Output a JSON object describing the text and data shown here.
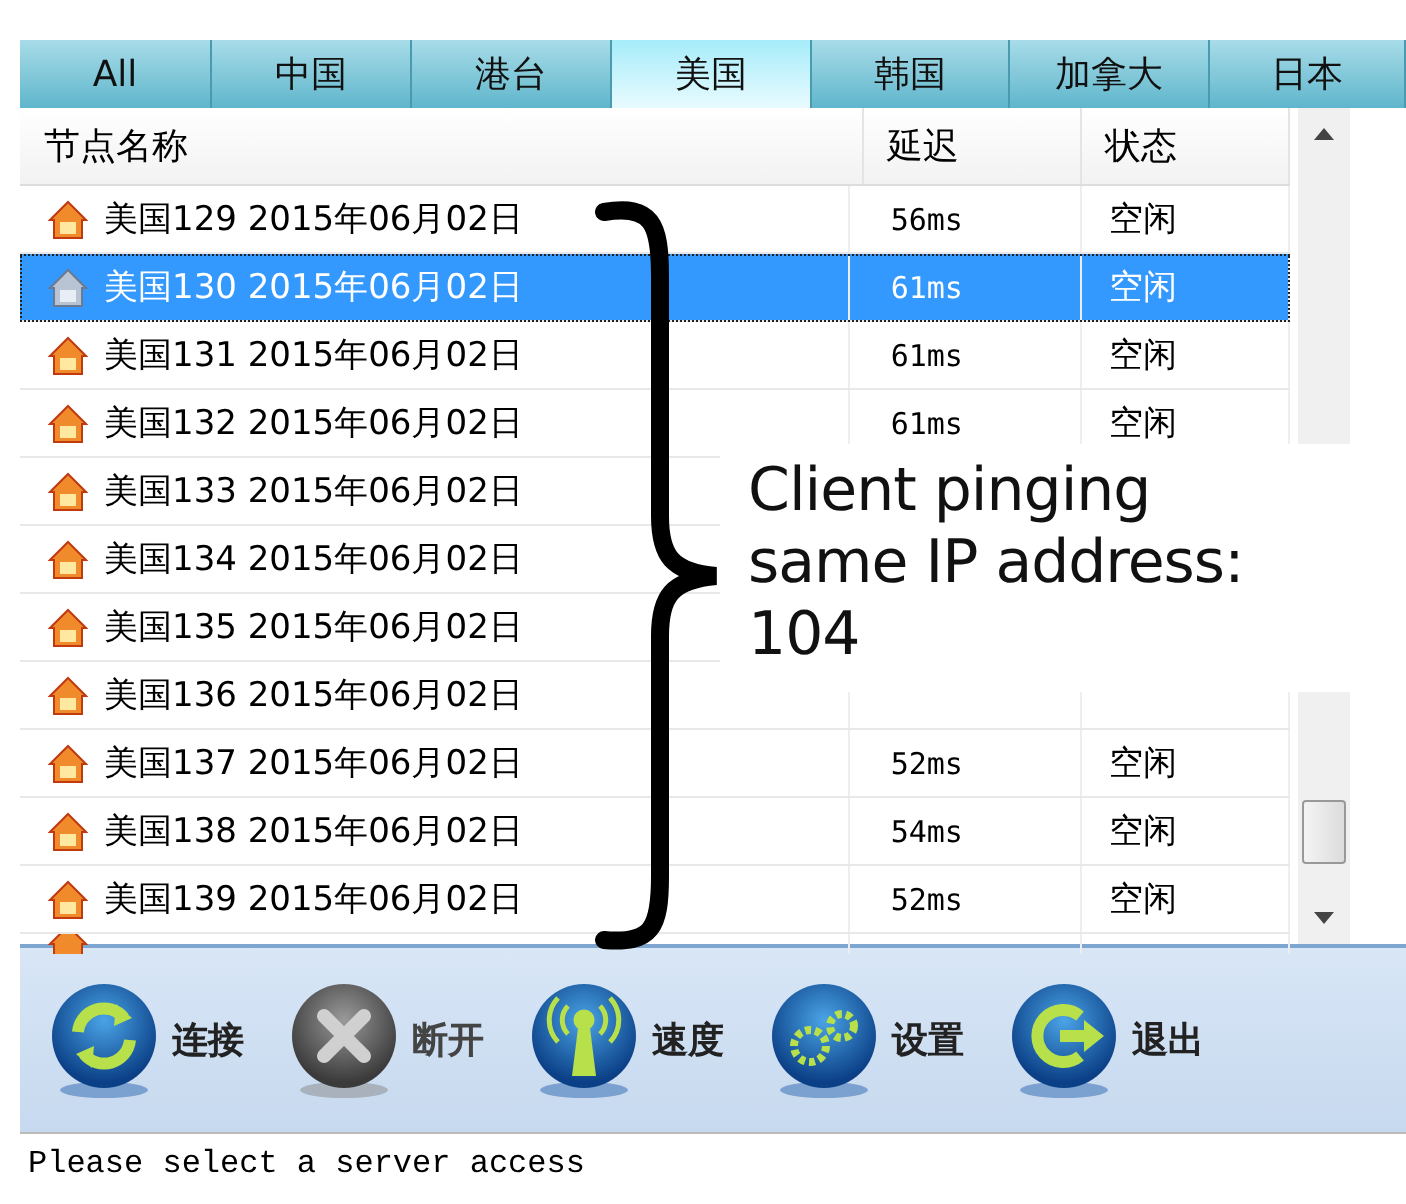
{
  "tabs": [
    {
      "label": "All",
      "selected": false
    },
    {
      "label": "中国",
      "selected": false
    },
    {
      "label": "港台",
      "selected": false
    },
    {
      "label": "美国",
      "selected": true
    },
    {
      "label": "韩国",
      "selected": false
    },
    {
      "label": "加拿大",
      "selected": false
    },
    {
      "label": "日本",
      "selected": false
    }
  ],
  "table": {
    "columns": [
      "节点名称",
      "延迟",
      "状态"
    ],
    "rows": [
      {
        "name": "美国129 2015年06月02日",
        "ping": "56ms",
        "status": "空闲",
        "selected": false
      },
      {
        "name": "美国130 2015年06月02日",
        "ping": "61ms",
        "status": "空闲",
        "selected": true
      },
      {
        "name": "美国131 2015年06月02日",
        "ping": "61ms",
        "status": "空闲",
        "selected": false
      },
      {
        "name": "美国132 2015年06月02日",
        "ping": "61ms",
        "status": "空闲",
        "selected": false
      },
      {
        "name": "美国133 2015年06月02日",
        "selected": false
      },
      {
        "name": "美国134 2015年06月02日",
        "selected": false
      },
      {
        "name": "美国135 2015年06月02日",
        "selected": false
      },
      {
        "name": "美国136 2015年06月02日",
        "selected": false
      },
      {
        "name": "美国137 2015年06月02日",
        "ping": "52ms",
        "status": "空闲",
        "selected": false
      },
      {
        "name": "美国138 2015年06月02日",
        "ping": "54ms",
        "status": "空闲",
        "selected": false
      },
      {
        "name": "美国139 2015年06月02日",
        "ping": "52ms",
        "status": "空闲",
        "selected": false
      }
    ]
  },
  "annotation": {
    "lines": [
      "Client pinging",
      "same IP address:",
      "104"
    ]
  },
  "toolbar": [
    {
      "label": "连接",
      "kind": "connect",
      "disabled": false
    },
    {
      "label": "断开",
      "kind": "disconnect",
      "disabled": true
    },
    {
      "label": "速度",
      "kind": "speed",
      "disabled": false
    },
    {
      "label": "设置",
      "kind": "settings",
      "disabled": false
    },
    {
      "label": "退出",
      "kind": "exit",
      "disabled": false
    }
  ],
  "status_bar": "Please select a server access"
}
